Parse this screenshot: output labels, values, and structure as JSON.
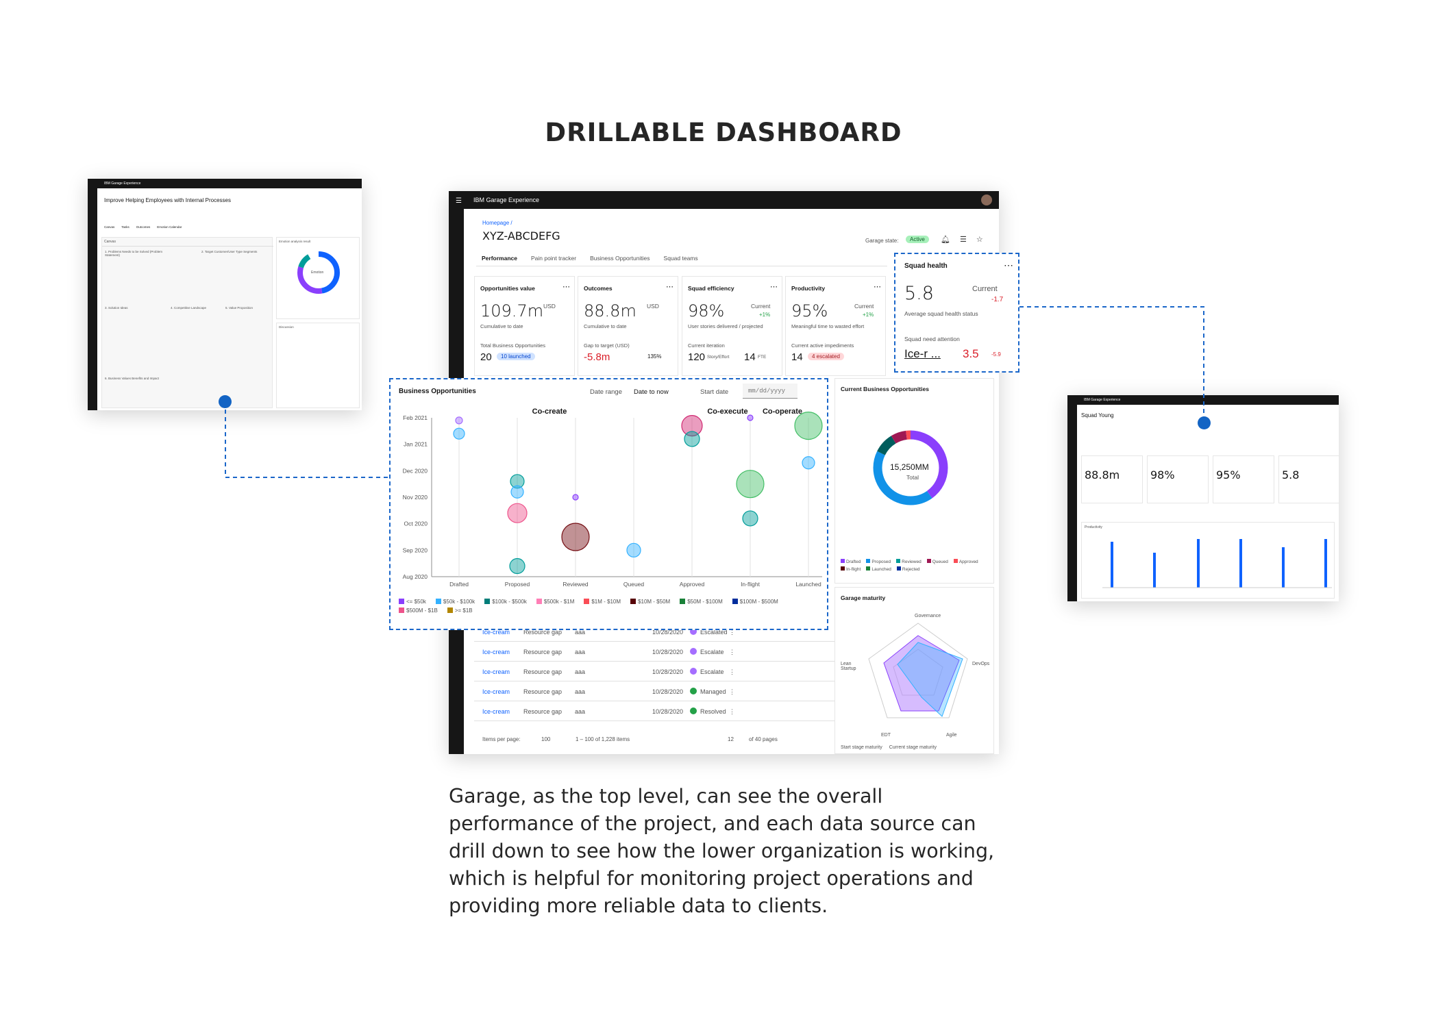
{
  "title": "DRILLABLE DASHBOARD",
  "caption": "Garage, as the top level, can see the overall performance of the project, and each data source can drill down to see how the lower organization is working, which is helpful for monitoring project operations and providing more reliable data to clients.",
  "left": {
    "app": "IBM Garage Experience",
    "heading": "Improve Helping Employees with Internal Processes",
    "tabs": [
      "Canvas",
      "Tasks",
      "Outcomes",
      "Emotion Calendar"
    ],
    "canvas": "Canvas",
    "emotion": "Emotion analysis result",
    "emotion_center": "Emotion",
    "discussion": "Discussion",
    "s1": "1. Problems Needs to be Solved (Problem Statement)",
    "s2": "2. Target Customer/User Type Segments",
    "s3": "3. Solution Ideas",
    "s4": "4. Competitive Landscape",
    "s5": "5. Value Proposition",
    "s6": "6. Business Values Benefits and Impact"
  },
  "main": {
    "app": "IBM Garage Experience",
    "crumb": "Homepage /",
    "heading": "XYZ-ABCDEFG",
    "state_label": "Garage state:",
    "state": "Active",
    "tabs": [
      "Performance",
      "Pain point tracker",
      "Business Opportunities",
      "Squad teams"
    ],
    "kpi": [
      {
        "title": "Opportunities value",
        "value": "109.7m",
        "unit": "USD",
        "sub": "Cumulative to date",
        "foot": "Total Business Opportunities",
        "fv": "20",
        "badge": "10 launched"
      },
      {
        "title": "Outcomes",
        "value": "88.8m",
        "unit": "USD",
        "sub": "Cumulative to date",
        "foot": "Gap to target (USD)",
        "fv": "-5.8m",
        "badge": "135%"
      },
      {
        "title": "Squad efficiency",
        "value": "98%",
        "unit": "Current",
        "delta": "+1%",
        "sub": "User stories delivered / projected",
        "foot": "Current iteration",
        "fv": "120",
        "fu": "Story/Effort",
        "fv2": "14",
        "fu2": "FTE"
      },
      {
        "title": "Productivity",
        "value": "95%",
        "unit": "Current",
        "delta": "+1%",
        "sub": "Meaningful time to wasted effort",
        "foot": "Current active impediments",
        "fv": "14",
        "badge": "4 escalated"
      }
    ],
    "health": {
      "title": "Squad health",
      "value": "5.8",
      "cur": "Current",
      "delta": "-1.7",
      "sub": "Average squad health status",
      "need": "Squad need attention",
      "name": "Ice-r ...",
      "nv": "3.5",
      "nd": "-5.9"
    },
    "bo": {
      "title": "Business Opportunities",
      "range_label": "Date range",
      "range": "Date to now",
      "start_label": "Start date",
      "start_ph": "mm/dd/yyyy",
      "groups": [
        "Co-create",
        "Co-execute",
        "Co-operate"
      ]
    },
    "donut": {
      "title": "Current Business Opportunities",
      "center": "15,250MM",
      "sub": "Total",
      "legend": [
        "Drafted",
        "Proposed",
        "Reviewed",
        "Queued",
        "Approved",
        "In-flight",
        "Launched",
        "Rejected"
      ]
    },
    "maturity": {
      "title": "Garage maturity",
      "axes": [
        "Governance",
        "DevOps",
        "Agile",
        "EDT",
        "Lean Startup"
      ],
      "legend": [
        "Start stage maturity",
        "Current stage maturity"
      ]
    },
    "table": {
      "rows": [
        {
          "name": "Ice-cream",
          "type": "Resource gap",
          "who": "aaa",
          "date": "10/28/2020",
          "status": "Escalated"
        },
        {
          "name": "Ice-cream",
          "type": "Resource gap",
          "who": "aaa",
          "date": "10/28/2020",
          "status": "Escalate"
        },
        {
          "name": "Ice-cream",
          "type": "Resource gap",
          "who": "aaa",
          "date": "10/28/2020",
          "status": "Escalate"
        },
        {
          "name": "Ice-cream",
          "type": "Resource gap",
          "who": "aaa",
          "date": "10/28/2020",
          "status": "Managed"
        },
        {
          "name": "Ice-cream",
          "type": "Resource gap",
          "who": "aaa",
          "date": "10/28/2020",
          "status": "Resolved"
        }
      ],
      "ipp": "Items per page:",
      "per": "100",
      "range": "1 – 100 of 1,228 items",
      "page": "12",
      "of": "of 40 pages"
    }
  },
  "right": {
    "app": "IBM Garage Experience",
    "heading": "Squad Young",
    "kpis": [
      "88.8m",
      "98%",
      "95%",
      "5.8"
    ],
    "chart": "Productivity"
  },
  "chart_data": {
    "type": "scatter",
    "title": "Business Opportunities",
    "categories": [
      "Drafted",
      "Proposed",
      "Reviewed",
      "Queued",
      "Approved",
      "In-flight",
      "Launched"
    ],
    "y_ticks": [
      "Aug 2020",
      "Sep 2020",
      "Oct 2020",
      "Nov 2020",
      "Dec 2020",
      "Jan 2021",
      "Feb 2021"
    ],
    "legend": [
      "<= $50k",
      "$50k - $100k",
      "$100k - $500k",
      "$500k - $1M",
      "$1M - $10M",
      "$10M - $50M",
      "$50M - $100M",
      "$100M - $500M",
      "$500M - $1B",
      ">= $1B"
    ],
    "legend_colors": [
      "#8a3ffc",
      "#33b1ff",
      "#007d79",
      "#ff7eb6",
      "#fa4d56",
      "#570408",
      "#198038",
      "#002d9c",
      "#ee538b",
      "#b28600"
    ]
  }
}
